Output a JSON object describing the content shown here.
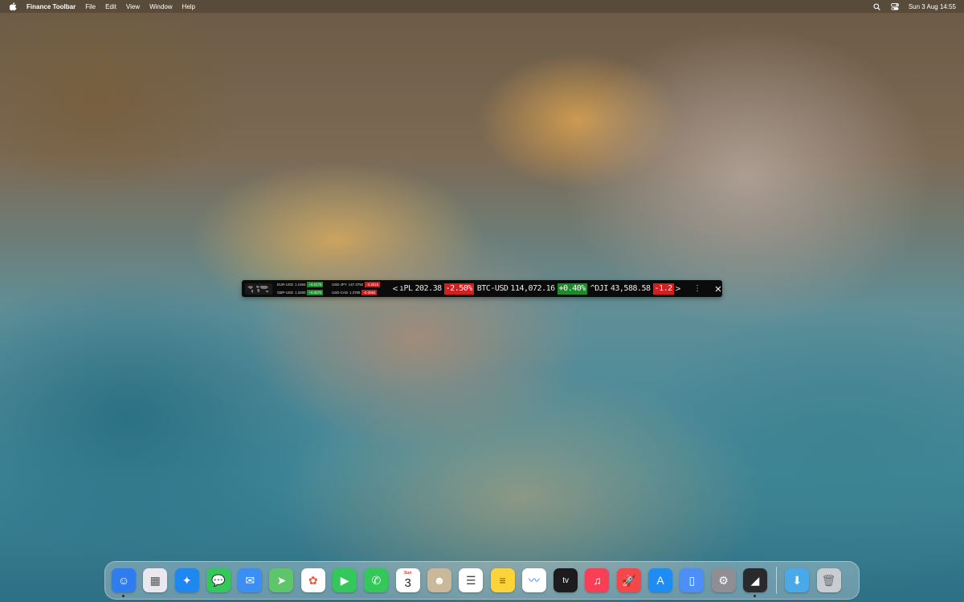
{
  "menubar": {
    "apple_icon": "apple-icon",
    "app_name": "Finance Toolbar",
    "menus": [
      "File",
      "Edit",
      "View",
      "Window",
      "Help"
    ],
    "clock": "Sun 3 Aug  14:55",
    "status_icons": [
      "search-icon",
      "control-center-icon"
    ]
  },
  "toolbar": {
    "fx": [
      {
        "pair": "EUR-USD",
        "price": "1.1594",
        "change": "+0.0175",
        "dir": "up"
      },
      {
        "pair": "USD-JPY",
        "price": "147.3750",
        "change": "-3.3016",
        "dir": "down"
      },
      {
        "pair": "GBP-USD",
        "price": "1.3280",
        "change": "+0.0070",
        "dir": "up"
      },
      {
        "pair": "USD-CAD",
        "price": "1.3785",
        "change": "-0.0062",
        "dir": "down"
      }
    ],
    "prev_label": "<",
    "next_label": ">",
    "more_label": "⋮",
    "tickers": [
      {
        "symbol": "ıPL",
        "value": "202.38",
        "change": "-2.50%",
        "dir": "down"
      },
      {
        "symbol": "BTC-USD",
        "value": "114,072.16",
        "change": "+0.40%",
        "dir": "up"
      },
      {
        "symbol": "^DJI",
        "value": "43,588.58",
        "change": "-1.2",
        "dir": "down"
      }
    ]
  },
  "dock": {
    "apps": [
      {
        "name": "Finder",
        "icon": "finder-icon",
        "bg": "#2f7bf0",
        "running": true
      },
      {
        "name": "Launchpad",
        "icon": "launchpad-icon",
        "bg": "#e8e8ee",
        "running": false
      },
      {
        "name": "Safari",
        "icon": "safari-icon",
        "bg": "#1e88f0",
        "running": false
      },
      {
        "name": "Messages",
        "icon": "messages-icon",
        "bg": "#34c759",
        "running": false
      },
      {
        "name": "Mail",
        "icon": "mail-icon",
        "bg": "#3b8ef3",
        "running": false
      },
      {
        "name": "Maps",
        "icon": "maps-icon",
        "bg": "#5fc56b",
        "running": false
      },
      {
        "name": "Photos",
        "icon": "photos-icon",
        "bg": "#ffffff",
        "running": false
      },
      {
        "name": "FaceTime",
        "icon": "facetime-icon",
        "bg": "#34c759",
        "running": false
      },
      {
        "name": "Phone",
        "icon": "phone-icon",
        "bg": "#34c759",
        "running": false
      },
      {
        "name": "Calendar",
        "icon": "calendar-icon",
        "bg": "#ffffff",
        "running": false,
        "month": "Sun",
        "day": "3"
      },
      {
        "name": "Contacts",
        "icon": "contacts-icon",
        "bg": "#c9b99a",
        "running": false
      },
      {
        "name": "Reminders",
        "icon": "reminders-icon",
        "bg": "#ffffff",
        "running": false
      },
      {
        "name": "Notes",
        "icon": "notes-icon",
        "bg": "#fbd43a",
        "running": false
      },
      {
        "name": "Freeform",
        "icon": "freeform-icon",
        "bg": "#ffffff",
        "running": false
      },
      {
        "name": "TV",
        "icon": "apple-tv-icon",
        "bg": "#1c1c1e",
        "running": false,
        "label": "tv"
      },
      {
        "name": "Music",
        "icon": "music-icon",
        "bg": "#fa3e55",
        "running": false
      },
      {
        "name": "Rocket",
        "icon": "rocket-icon",
        "bg": "#f4474a",
        "running": false
      },
      {
        "name": "App Store",
        "icon": "app-store-icon",
        "bg": "#1d8cf3",
        "running": false
      },
      {
        "name": "Simulator",
        "icon": "simulator-icon",
        "bg": "#4d8ef7",
        "running": false
      },
      {
        "name": "System Settings",
        "icon": "settings-icon",
        "bg": "#8e8e93",
        "running": false
      },
      {
        "name": "Finance Toolbar",
        "icon": "finance-chart-icon",
        "bg": "#2a2a2c",
        "running": true
      }
    ],
    "folders": [
      {
        "name": "Downloads",
        "icon": "downloads-folder-icon",
        "bg": "#4aa9e8"
      },
      {
        "name": "Trash",
        "icon": "trash-icon",
        "bg": "#c9ccd1"
      }
    ]
  }
}
